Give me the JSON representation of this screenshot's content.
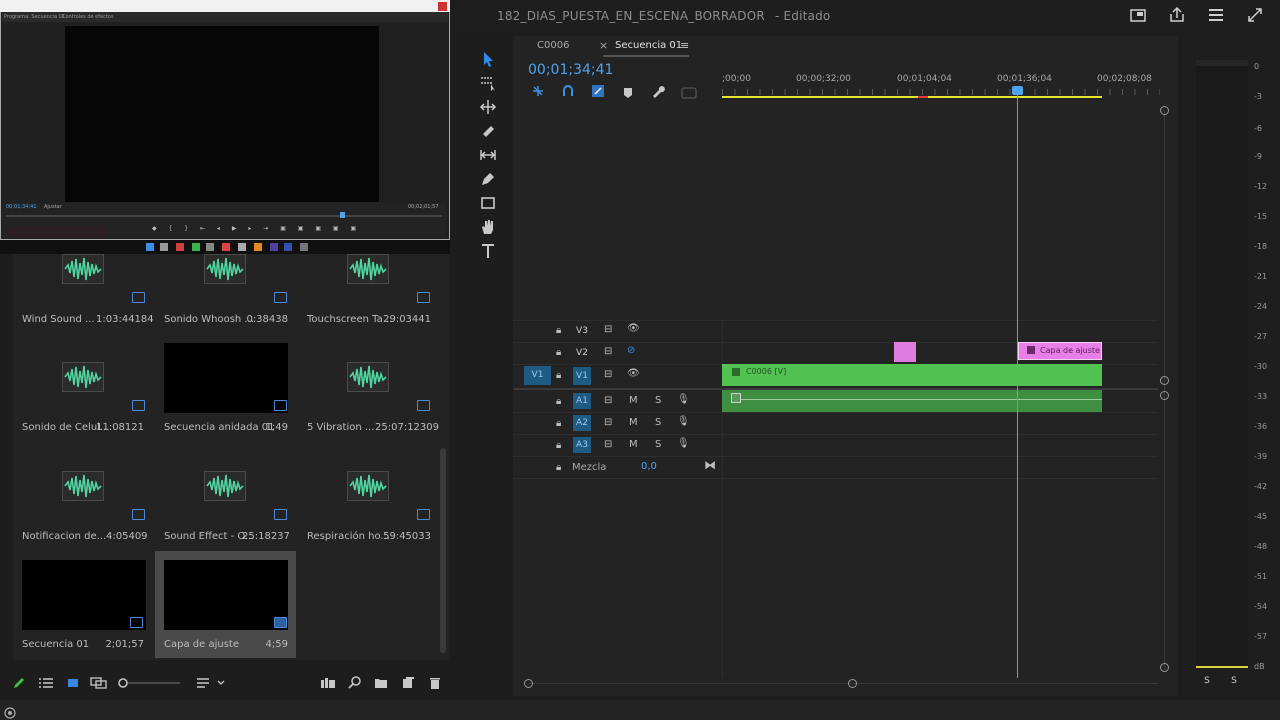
{
  "window": {
    "project_title": "182_DIAS_PUESTA_EN_ESCENA_BORRADOR",
    "edited_status": "- Editado"
  },
  "monitor": {
    "tab_program": "Programa: Secuencia 01",
    "tab_effects": "Controles de efectos",
    "timecode": "00;01;34;41",
    "fit": "Ajustar",
    "duration": "00;02;01;57"
  },
  "project_bin": {
    "items": [
      {
        "name": "Wind Sound ...",
        "duration": "1:03:44184",
        "kind": "audio"
      },
      {
        "name": "Sonido  Whoosh ...",
        "duration": "0:38438",
        "kind": "audio"
      },
      {
        "name": "Touchscreen Ta...",
        "duration": "29:03441",
        "kind": "audio"
      },
      {
        "name": "Sonido de Celul...",
        "duration": "11:08121",
        "kind": "audio"
      },
      {
        "name": "Secuencia anidada 01",
        "duration": "1;49",
        "kind": "sequence"
      },
      {
        "name": "5 Vibration ...",
        "duration": "25:07:12309",
        "kind": "audio"
      },
      {
        "name": "Notificacion de...",
        "duration": "4:05409",
        "kind": "audio"
      },
      {
        "name": "Sound Effect - O...",
        "duration": "25:18237",
        "kind": "audio"
      },
      {
        "name": "Respiración ho...",
        "duration": "59:45033",
        "kind": "audio"
      },
      {
        "name": "Secuencia 01",
        "duration": "2;01;57",
        "kind": "sequence"
      },
      {
        "name": "Capa de ajuste",
        "duration": "4;59",
        "kind": "adjustment",
        "selected": true
      }
    ]
  },
  "timeline": {
    "tabs": [
      {
        "label": "C0006"
      },
      {
        "label": "Secuencia 01",
        "active": true
      }
    ],
    "timecode": "00;01;34;41",
    "ruler": [
      ";00;00",
      "00;00;32;00",
      "00;01;04;04",
      "00;01;36;04",
      "00;02;08;08"
    ],
    "tracks": {
      "video": [
        "V3",
        "V2",
        "V1"
      ],
      "source_patch": "V1",
      "audio": [
        "A1",
        "A2",
        "A3"
      ],
      "mute": "M",
      "solo": "S"
    },
    "mix_label": "Mezcla",
    "mix_value": "0,0",
    "clips": {
      "v1": "C0006 [V]",
      "v2_adjustment": "Capa de ajuste"
    }
  },
  "meters": {
    "db_scale": [
      "0",
      "-3",
      "-6",
      "-9",
      "-12",
      "-15",
      "-18",
      "-21",
      "-24",
      "-27",
      "-30",
      "-33",
      "-36",
      "-39",
      "-42",
      "-45",
      "-48",
      "-51",
      "-54",
      "-57",
      "dB"
    ],
    "solo_left": "S",
    "solo_right": "S"
  },
  "colors": {
    "timecode_blue": "#4ea2ee",
    "clip_video_green": "#52c352",
    "clip_audio_green": "#3f8f42",
    "clip_adjustment_pink": "#e87fe8",
    "work_area_yellow": "#e8e230"
  }
}
